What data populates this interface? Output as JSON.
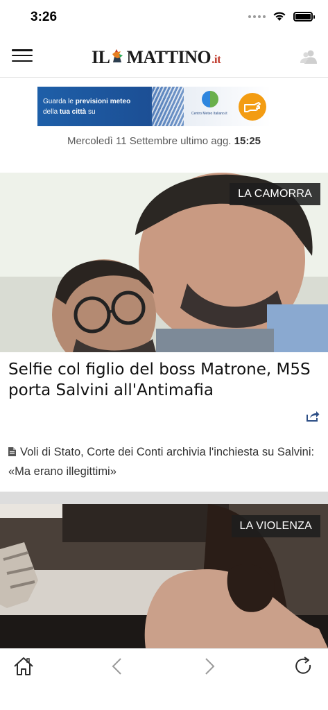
{
  "status_bar": {
    "time": "3:26"
  },
  "header": {
    "logo_left": "IL",
    "logo_main": "MATTINO",
    "logo_suffix": ".it"
  },
  "banner": {
    "line1_prefix": "Guarda le ",
    "line1_bold": "previsioni meteo",
    "line2_prefix": "della ",
    "line2_bold": "tua città",
    "line2_suffix": " su",
    "brand": "Centro Meteo Italiano.it"
  },
  "dateline": {
    "text": "Mercoledì 11 Settembre ultimo agg. ",
    "time": "15:25"
  },
  "articles": [
    {
      "category": "LA CAMORRA",
      "headline": "Selfie col figlio del boss Matrone, M5S porta Salvini all'Antimafia",
      "related": "Voli di Stato, Corte dei Conti archivia l'inchiesta su Salvini: «Ma erano illegittimi»"
    },
    {
      "category": "LA VIOLENZA"
    }
  ],
  "toolbar": {
    "icons": [
      "home-icon",
      "back-icon",
      "forward-icon",
      "reload-icon"
    ]
  },
  "colors": {
    "logo_accent": "#c0392b",
    "tag_background": "#1e1e1e",
    "divider": "#dddddd"
  }
}
